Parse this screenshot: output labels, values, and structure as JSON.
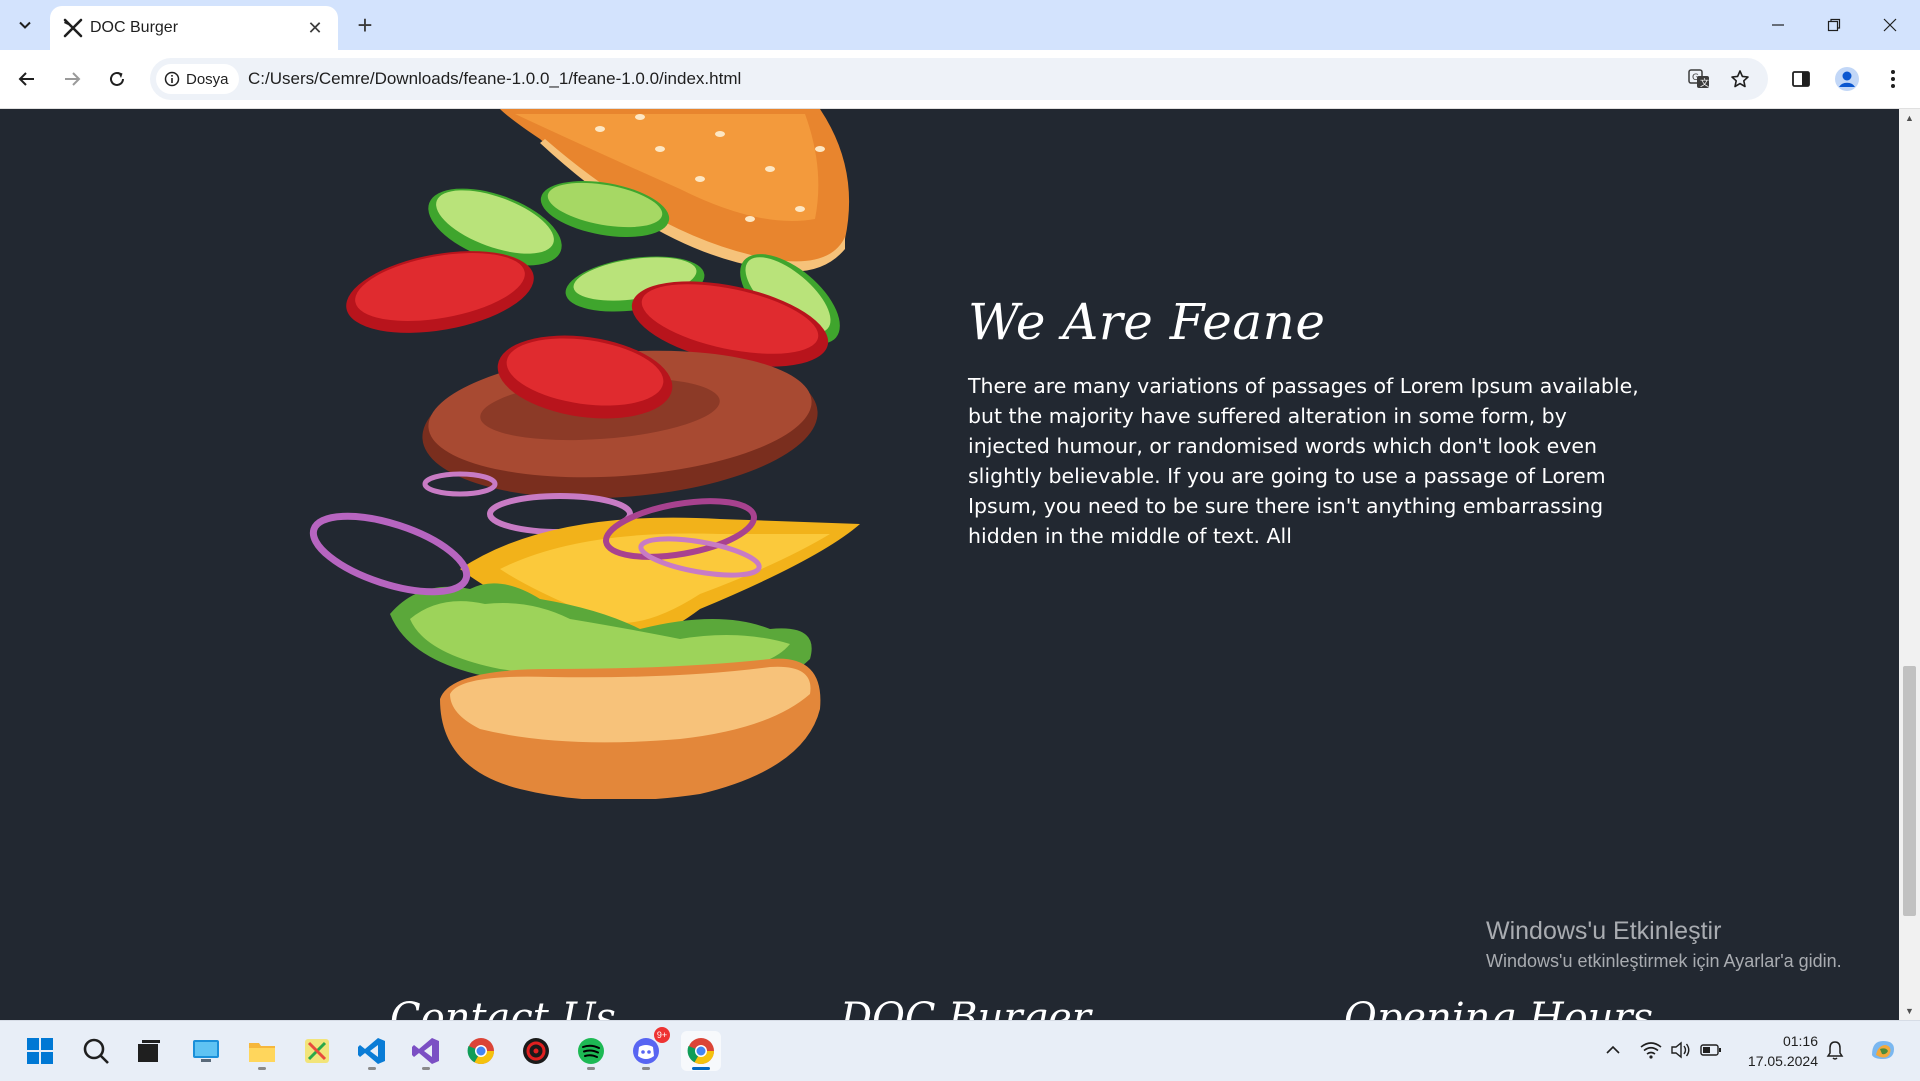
{
  "browser": {
    "tab_title": "DOC Burger",
    "site_info_label": "Dosya",
    "url": "C:/Users/Cemre/Downloads/feane-1.0.0_1/feane-1.0.0/index.html"
  },
  "page": {
    "about": {
      "title": "We Are Feane",
      "text": "There are many variations of passages of Lorem Ipsum available, but the majority have suffered alteration in some form, by injected humour, or randomised words which don't look even slightly believable. If you are going to use a passage of Lorem Ipsum, you need to be sure there isn't anything embarrassing hidden in the middle of text. All"
    },
    "footer_peek": {
      "left": "Contact Us",
      "center": "DOC Burger",
      "right": "Opening Hours"
    }
  },
  "watermark": {
    "title": "Windows'u Etkinleştir",
    "subtitle": "Windows'u etkinleştirmek için Ayarlar'a gidin."
  },
  "taskbar": {
    "apps": [
      "start-icon",
      "search-icon",
      "task-view-icon",
      "desktop-icon",
      "file-explorer-icon",
      "paint-icon",
      "vscode-icon",
      "visual-studio-icon",
      "chrome-icon",
      "game-app-icon",
      "spotify-icon",
      "discord-icon",
      "chrome-active-icon"
    ],
    "discord_badge": "9+",
    "clock_time": "01:16",
    "clock_date": "17.05.2024"
  },
  "colors": {
    "page_background": "#222831",
    "tabbar": "#d3e3fd",
    "accent": "#0067c0"
  }
}
